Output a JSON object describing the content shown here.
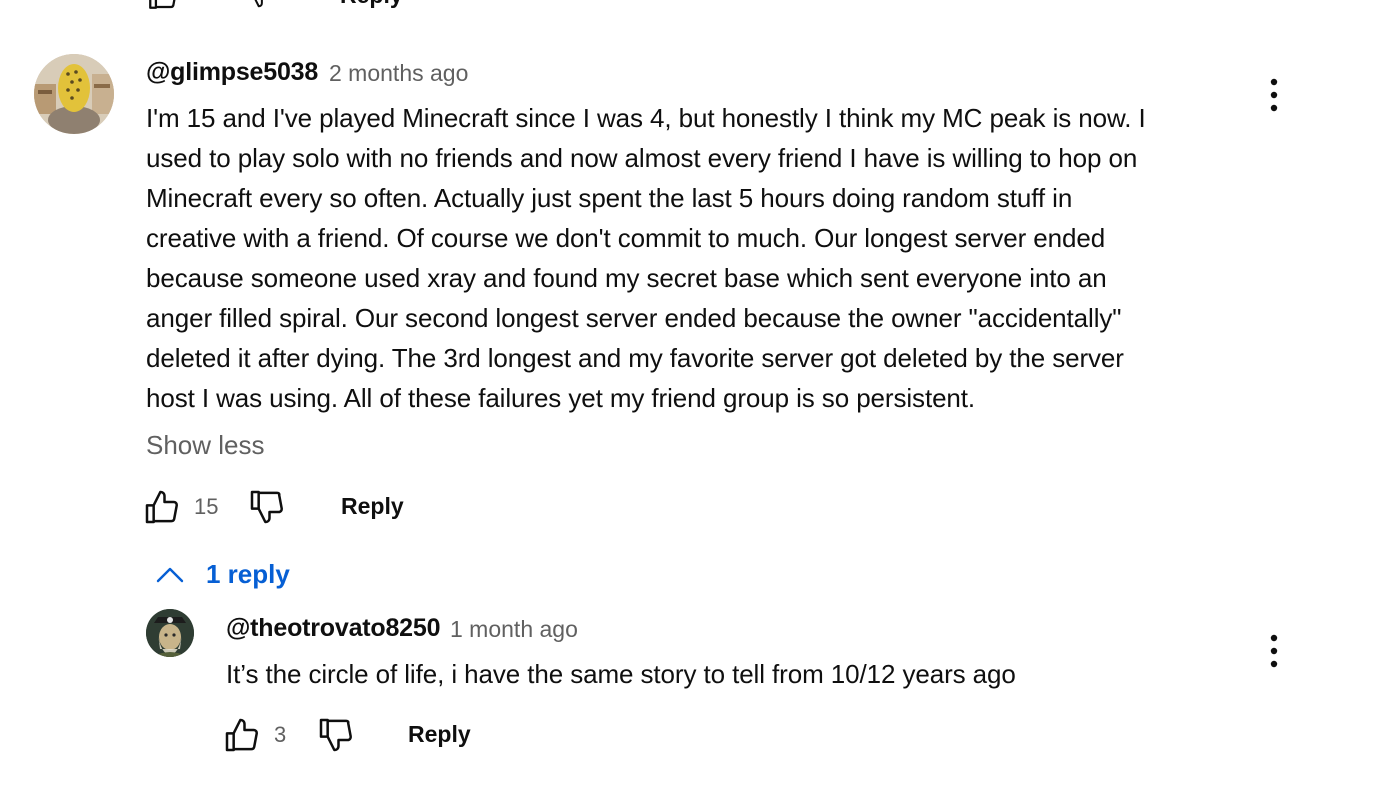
{
  "top_partial": {
    "reply_label": "Reply"
  },
  "comment": {
    "author": "@glimpse5038",
    "time": "2 months ago",
    "lines": [
      "I'm 15 and I've played Minecraft since I was 4, but honestly I think my MC peak is now. I",
      "used to play solo with no friends and now almost every friend I have is willing to hop on",
      "Minecraft every so often. Actually just spent the last 5 hours doing random stuff in",
      "creative with a friend. Of course we don't commit to much. Our longest server ended",
      "because someone used xray and found my secret base which sent everyone into an",
      "anger filled spiral. Our second longest server ended because the owner \"accidentally\"",
      "deleted it after dying. The 3rd longest and my favorite server got deleted by the server",
      "host I was using. All of these failures yet my friend group is so persistent."
    ],
    "show_less": "Show less",
    "likes": "15",
    "reply_label": "Reply",
    "replies_toggle": "1 reply"
  },
  "reply": {
    "author": "@theotrovato8250",
    "time": "1 month ago",
    "text": "It’s the circle of life, i have the same story to tell from 10/12 years ago",
    "likes": "3",
    "reply_label": "Reply"
  },
  "colors": {
    "link": "#065fd4",
    "secondary": "#606060",
    "primary": "#0f0f0f"
  }
}
